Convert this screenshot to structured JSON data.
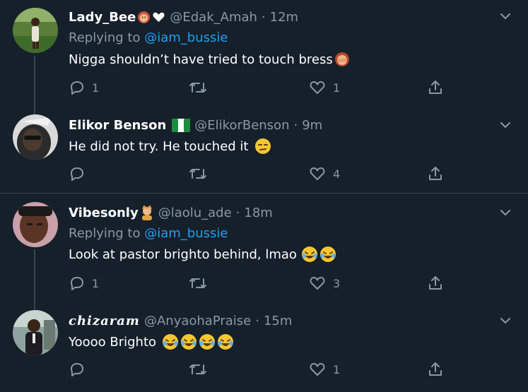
{
  "tweets": [
    {
      "name": "Lady_Bee",
      "handle": "@Edak_Amah",
      "time": "12m",
      "replying_prefix": "Replying to",
      "replying_to": "@iam_bussie",
      "text": "Nigga shouldn’t have tried to touch bress",
      "replies": "1",
      "retweets": "",
      "likes": "1"
    },
    {
      "name": "Elikor Benson",
      "handle": "@ElikorBenson",
      "time": "9m",
      "text": "He did not try. He touched it",
      "replies": "",
      "retweets": "",
      "likes": "4"
    },
    {
      "name": "Vibesonly",
      "handle": "@laolu_ade",
      "time": "18m",
      "replying_prefix": "Replying to",
      "replying_to": "@iam_bussie",
      "text": "Look at pastor brighto behind, lmao",
      "replies": "1",
      "retweets": "",
      "likes": "3"
    },
    {
      "name": "chizaram",
      "handle": "@AnyaohaPraise",
      "time": "15m",
      "text": "Yoooo Brighto",
      "replies": "",
      "retweets": "",
      "likes": "1"
    }
  ],
  "separator": "·",
  "colors": {
    "background": "#15202b",
    "secondary_text": "#8899a6",
    "link": "#1da1f2",
    "divider": "#38444d"
  },
  "icons": [
    "reply-icon",
    "retweet-icon",
    "like-icon",
    "share-icon",
    "chevron-down-icon",
    "white-heart-emoji",
    "nigeria-flag-emoji",
    "laughing-tears-emoji",
    "unamused-emoji",
    "facepalm-emoji",
    "massage-emoji",
    "person-emoji"
  ]
}
